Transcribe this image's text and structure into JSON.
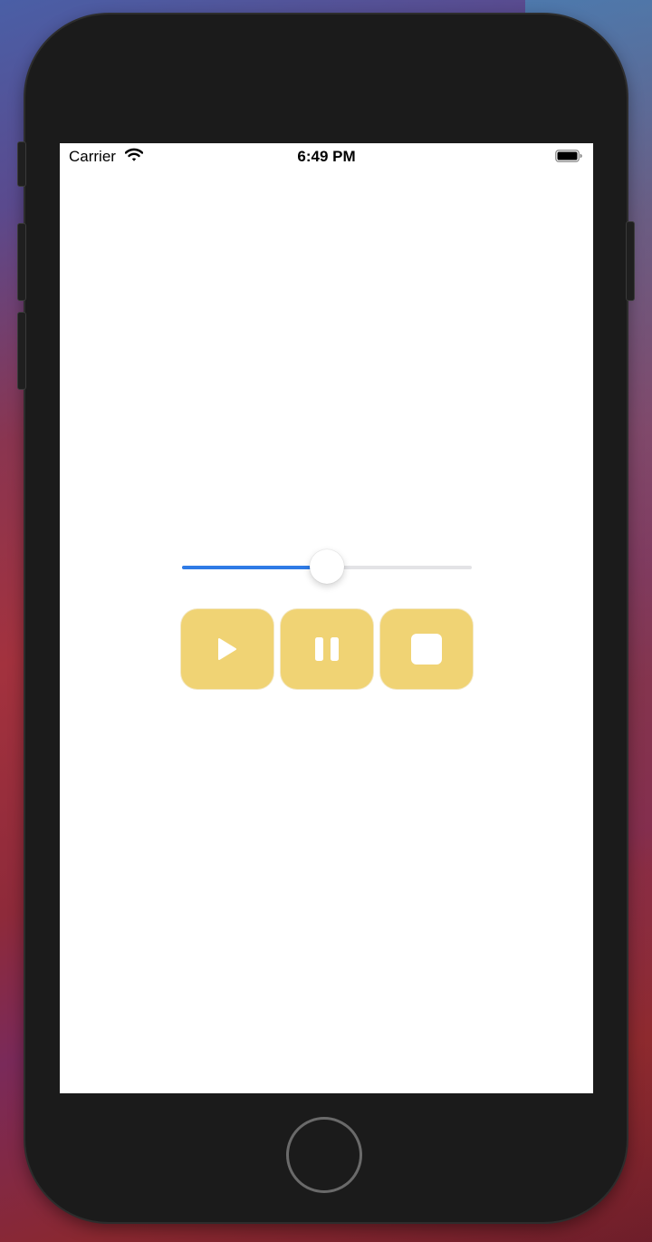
{
  "status_bar": {
    "carrier": "Carrier",
    "time": "6:49 PM",
    "wifi_icon": "wifi-icon",
    "battery_icon": "battery-icon"
  },
  "player": {
    "progress": 0.5,
    "progress_color": "#2f7be6",
    "track_color": "#e3e3e6",
    "button_color": "#f0d374",
    "buttons": [
      {
        "name": "play",
        "icon": "play-icon"
      },
      {
        "name": "pause",
        "icon": "pause-icon"
      },
      {
        "name": "stop",
        "icon": "stop-icon"
      }
    ]
  }
}
